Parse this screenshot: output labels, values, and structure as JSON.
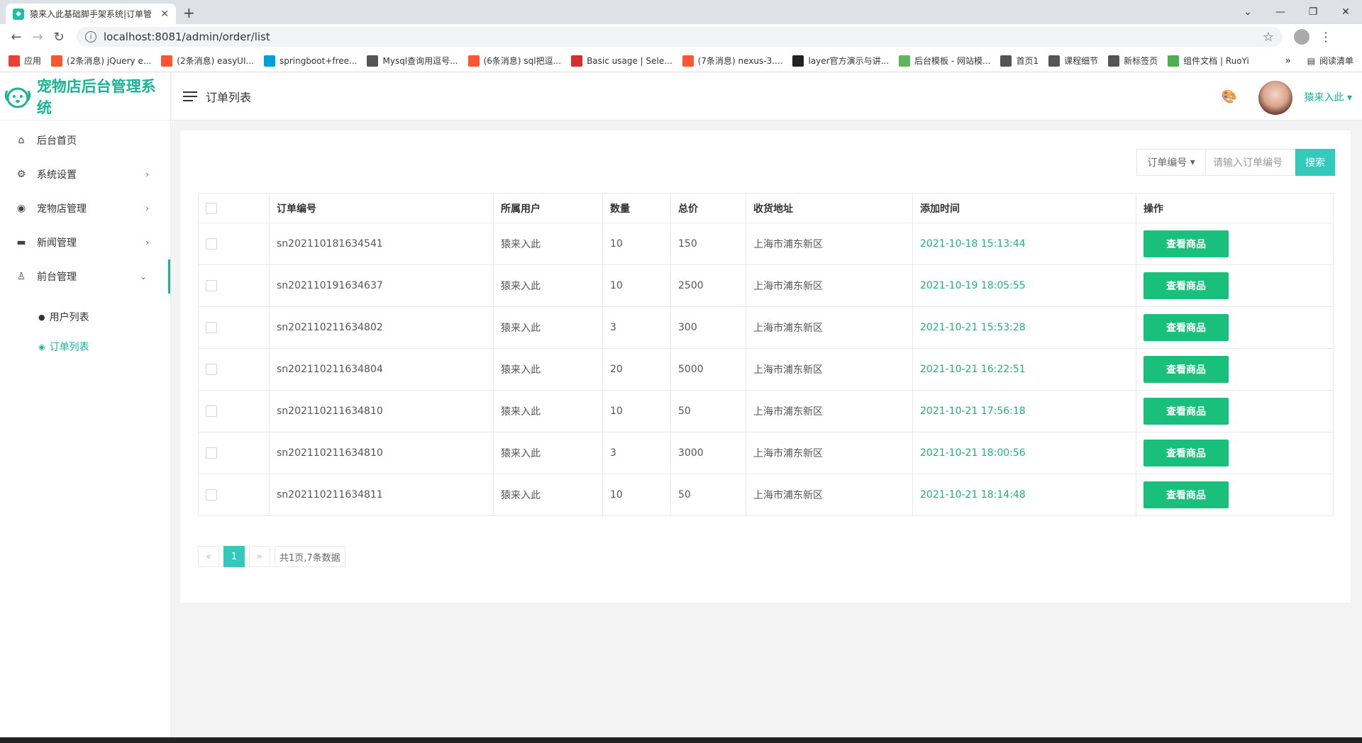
{
  "browser": {
    "tab_title": "猿来入此基础脚手架系统|订单管",
    "url": "localhost:8081/admin/order/list",
    "bookmarks": [
      {
        "label": "应用",
        "icon": "apps-icon",
        "color": "#e94235"
      },
      {
        "label": "(2条消息) jQuery e...",
        "icon": "csdn-icon",
        "color": "#fc5531"
      },
      {
        "label": "(2条消息) easyUI...",
        "icon": "csdn-icon",
        "color": "#fc5531"
      },
      {
        "label": "springboot+free...",
        "icon": "bilibili-icon",
        "color": "#00a1d6"
      },
      {
        "label": "Mysql查询用逗号...",
        "icon": "bookmark-icon",
        "color": "#555555"
      },
      {
        "label": "(6条消息) sql把逗...",
        "icon": "csdn-icon",
        "color": "#fc5531"
      },
      {
        "label": "Basic usage | Sele...",
        "icon": "layers-icon",
        "color": "#d32f2f"
      },
      {
        "label": "(7条消息) nexus-3....",
        "icon": "csdn-icon",
        "color": "#fc5531"
      },
      {
        "label": "layer官方演示与讲...",
        "icon": "layer-icon",
        "color": "#222222"
      },
      {
        "label": "后台模板 - 网站模...",
        "icon": "m-icon",
        "color": "#5cb85c"
      },
      {
        "label": "首页1",
        "icon": "globe-icon",
        "color": "#555555"
      },
      {
        "label": "课程细节",
        "icon": "globe-icon",
        "color": "#555555"
      },
      {
        "label": "新标签页",
        "icon": "globe-icon",
        "color": "#555555"
      },
      {
        "label": "组件文档 | RuoYi",
        "icon": "ruoyi-icon",
        "color": "#4caf50"
      }
    ],
    "overflow": "»",
    "reading_list": "阅读清单"
  },
  "app": {
    "logo_text": "宠物店后台管理系统",
    "page_title": "订单列表",
    "username": "猿来入此",
    "accent": "#1ab394"
  },
  "sidebar": {
    "items": [
      {
        "label": "后台首页",
        "icon": "home-icon",
        "arrow": ""
      },
      {
        "label": "系统设置",
        "icon": "gear-icon",
        "arrow": "›"
      },
      {
        "label": "宠物店管理",
        "icon": "pet-icon",
        "arrow": "›"
      },
      {
        "label": "新闻管理",
        "icon": "news-icon",
        "arrow": "›"
      },
      {
        "label": "前台管理",
        "icon": "user-icon",
        "arrow": "⌄"
      }
    ],
    "sub_items": [
      {
        "label": "用户列表",
        "icon": "user-circle-icon"
      },
      {
        "label": "订单列表",
        "icon": "dot-circle-icon"
      }
    ]
  },
  "search": {
    "select_label": "订单编号",
    "placeholder": "请输入订单编号",
    "button": "搜索"
  },
  "table": {
    "headers": [
      "订单编号",
      "所属用户",
      "数量",
      "总价",
      "收货地址",
      "添加时间",
      "操作"
    ],
    "action_label": "查看商品",
    "rows": [
      {
        "sn": "sn202110181634541",
        "user": "猿来入此",
        "qty": "10",
        "total": "150",
        "address": "上海市浦东新区",
        "time": "2021-10-18 15:13:44"
      },
      {
        "sn": "sn202110191634637",
        "user": "猿来入此",
        "qty": "10",
        "total": "2500",
        "address": "上海市浦东新区",
        "time": "2021-10-19 18:05:55"
      },
      {
        "sn": "sn202110211634802",
        "user": "猿来入此",
        "qty": "3",
        "total": "300",
        "address": "上海市浦东新区",
        "time": "2021-10-21 15:53:28"
      },
      {
        "sn": "sn202110211634804",
        "user": "猿来入此",
        "qty": "20",
        "total": "5000",
        "address": "上海市浦东新区",
        "time": "2021-10-21 16:22:51"
      },
      {
        "sn": "sn202110211634810",
        "user": "猿来入此",
        "qty": "10",
        "total": "50",
        "address": "上海市浦东新区",
        "time": "2021-10-21 17:56:18"
      },
      {
        "sn": "sn202110211634810",
        "user": "猿来入此",
        "qty": "3",
        "total": "3000",
        "address": "上海市浦东新区",
        "time": "2021-10-21 18:00:56"
      },
      {
        "sn": "sn202110211634811",
        "user": "猿来入此",
        "qty": "10",
        "total": "50",
        "address": "上海市浦东新区",
        "time": "2021-10-21 18:14:48"
      }
    ]
  },
  "pagination": {
    "prev": "«",
    "current": "1",
    "next": "»",
    "summary": "共1页,7条数据"
  }
}
